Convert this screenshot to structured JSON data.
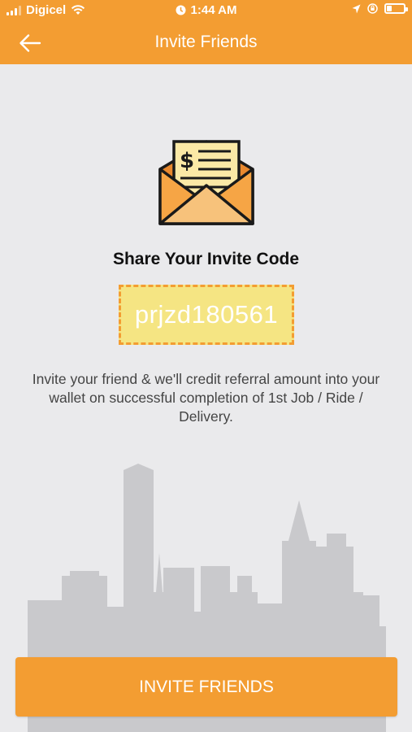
{
  "status_bar": {
    "carrier": "Digicel",
    "time": "1:44 AM",
    "icons": [
      "signal-icon",
      "wifi-icon",
      "alarm-icon",
      "location-icon",
      "orientation-lock-icon",
      "battery-icon"
    ]
  },
  "header": {
    "title": "Invite Friends",
    "back_icon": "back-arrow-icon"
  },
  "main": {
    "illustration": "envelope-money-icon",
    "share_title": "Share Your Invite Code",
    "invite_code": "prjzd180561",
    "description": "Invite your friend & we'll credit referral amount into your wallet on successful completion of 1st Job / Ride / Delivery."
  },
  "footer": {
    "button_label": "INVITE FRIENDS"
  },
  "colors": {
    "accent": "#f39d32",
    "code_background": "#f5e583",
    "background": "#eaeaec",
    "skyline": "#c9c9cc"
  }
}
